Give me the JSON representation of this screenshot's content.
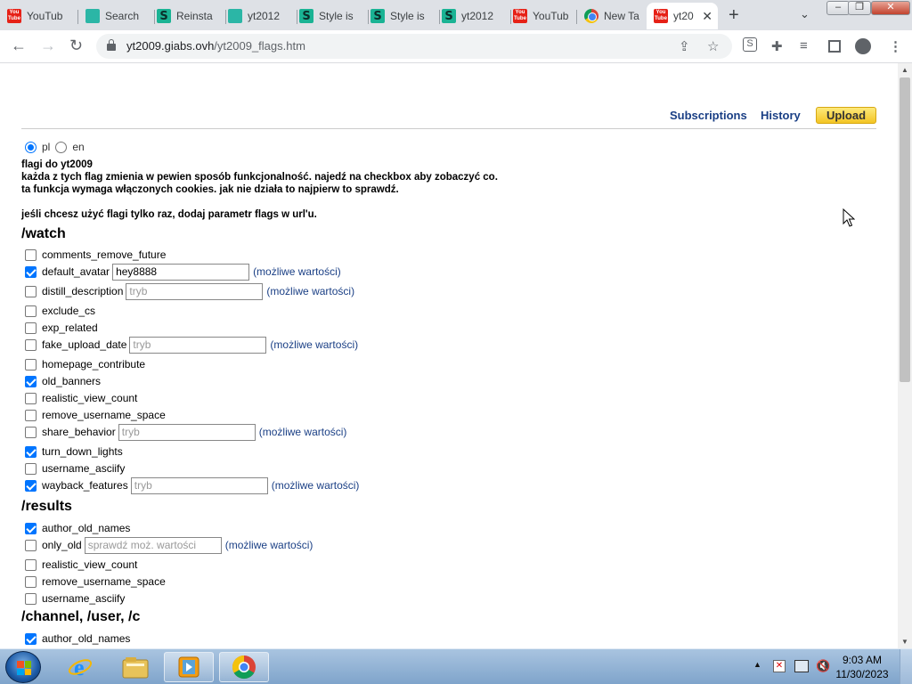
{
  "browser": {
    "tabs": [
      {
        "title": "YouTub",
        "favicon": "youtube-icon",
        "active": false
      },
      {
        "title": "Search",
        "favicon": "globe-teal-icon",
        "active": false
      },
      {
        "title": "Reinsta",
        "favicon": "stylish-s-icon",
        "active": false
      },
      {
        "title": "yt2012",
        "favicon": "globe-teal-icon",
        "active": false
      },
      {
        "title": "Style is",
        "favicon": "stylish-s-icon",
        "active": false
      },
      {
        "title": "Style is",
        "favicon": "stylish-s-icon",
        "active": false
      },
      {
        "title": "yt2012",
        "favicon": "stylish-s-icon",
        "active": false
      },
      {
        "title": "YouTub",
        "favicon": "youtube-icon",
        "active": false
      },
      {
        "title": "New Ta",
        "favicon": "chrome-icon",
        "active": false
      },
      {
        "title": "yt20",
        "favicon": "youtube-icon",
        "active": true
      }
    ],
    "url_host": "yt2009.giabs.ovh",
    "url_path": "/yt2009_flags.htm"
  },
  "page": {
    "nav": {
      "subscriptions": "Subscriptions",
      "history": "History",
      "upload": "Upload"
    },
    "lang": {
      "pl": "pl",
      "en": "en",
      "selected": "pl"
    },
    "intro": {
      "line1": "flagi do yt2009",
      "line2": "każda z tych flag zmienia w pewien sposób funkcjonalność. najedź na checkbox aby zobaczyć co.",
      "line3": "ta funkcja wymaga włączonych cookies. jak nie działa to najpierw to sprawdź.",
      "line4": "jeśli chcesz użyć flagi tylko raz, dodaj parametr flags w url'u."
    },
    "sections": {
      "watch": {
        "title": "/watch",
        "flags": [
          {
            "name": "comments_remove_future",
            "checked": false
          },
          {
            "name": "default_avatar",
            "checked": true,
            "value": "hey8888",
            "placeholder": "",
            "link": "(możliwe wartości)"
          },
          {
            "name": "distill_description",
            "checked": false,
            "value": "",
            "placeholder": "tryb",
            "link": "(możliwe wartości)"
          },
          {
            "name": "exclude_cs",
            "checked": false
          },
          {
            "name": "exp_related",
            "checked": false
          },
          {
            "name": "fake_upload_date",
            "checked": false,
            "value": "",
            "placeholder": "tryb",
            "link": "(możliwe wartości)"
          },
          {
            "name": "homepage_contribute",
            "checked": false
          },
          {
            "name": "old_banners",
            "checked": true
          },
          {
            "name": "realistic_view_count",
            "checked": false
          },
          {
            "name": "remove_username_space",
            "checked": false
          },
          {
            "name": "share_behavior",
            "checked": false,
            "value": "",
            "placeholder": "tryb",
            "link": "(możliwe wartości)"
          },
          {
            "name": "turn_down_lights",
            "checked": true
          },
          {
            "name": "username_asciify",
            "checked": false
          },
          {
            "name": "wayback_features",
            "checked": true,
            "value": "",
            "placeholder": "tryb",
            "link": "(możliwe wartości)"
          }
        ]
      },
      "results": {
        "title": "/results",
        "flags": [
          {
            "name": "author_old_names",
            "checked": true
          },
          {
            "name": "only_old",
            "checked": false,
            "value": "",
            "placeholder": "sprawdź moż. wartości",
            "link": "(możliwe wartości)"
          },
          {
            "name": "realistic_view_count",
            "checked": false
          },
          {
            "name": "remove_username_space",
            "checked": false
          },
          {
            "name": "username_asciify",
            "checked": false
          }
        ]
      },
      "channel": {
        "title": "/channel, /user, /c",
        "flags": [
          {
            "name": "author_old_names",
            "checked": true
          }
        ]
      }
    }
  },
  "taskbar": {
    "time": "9:03 AM",
    "date": "11/30/2023"
  }
}
